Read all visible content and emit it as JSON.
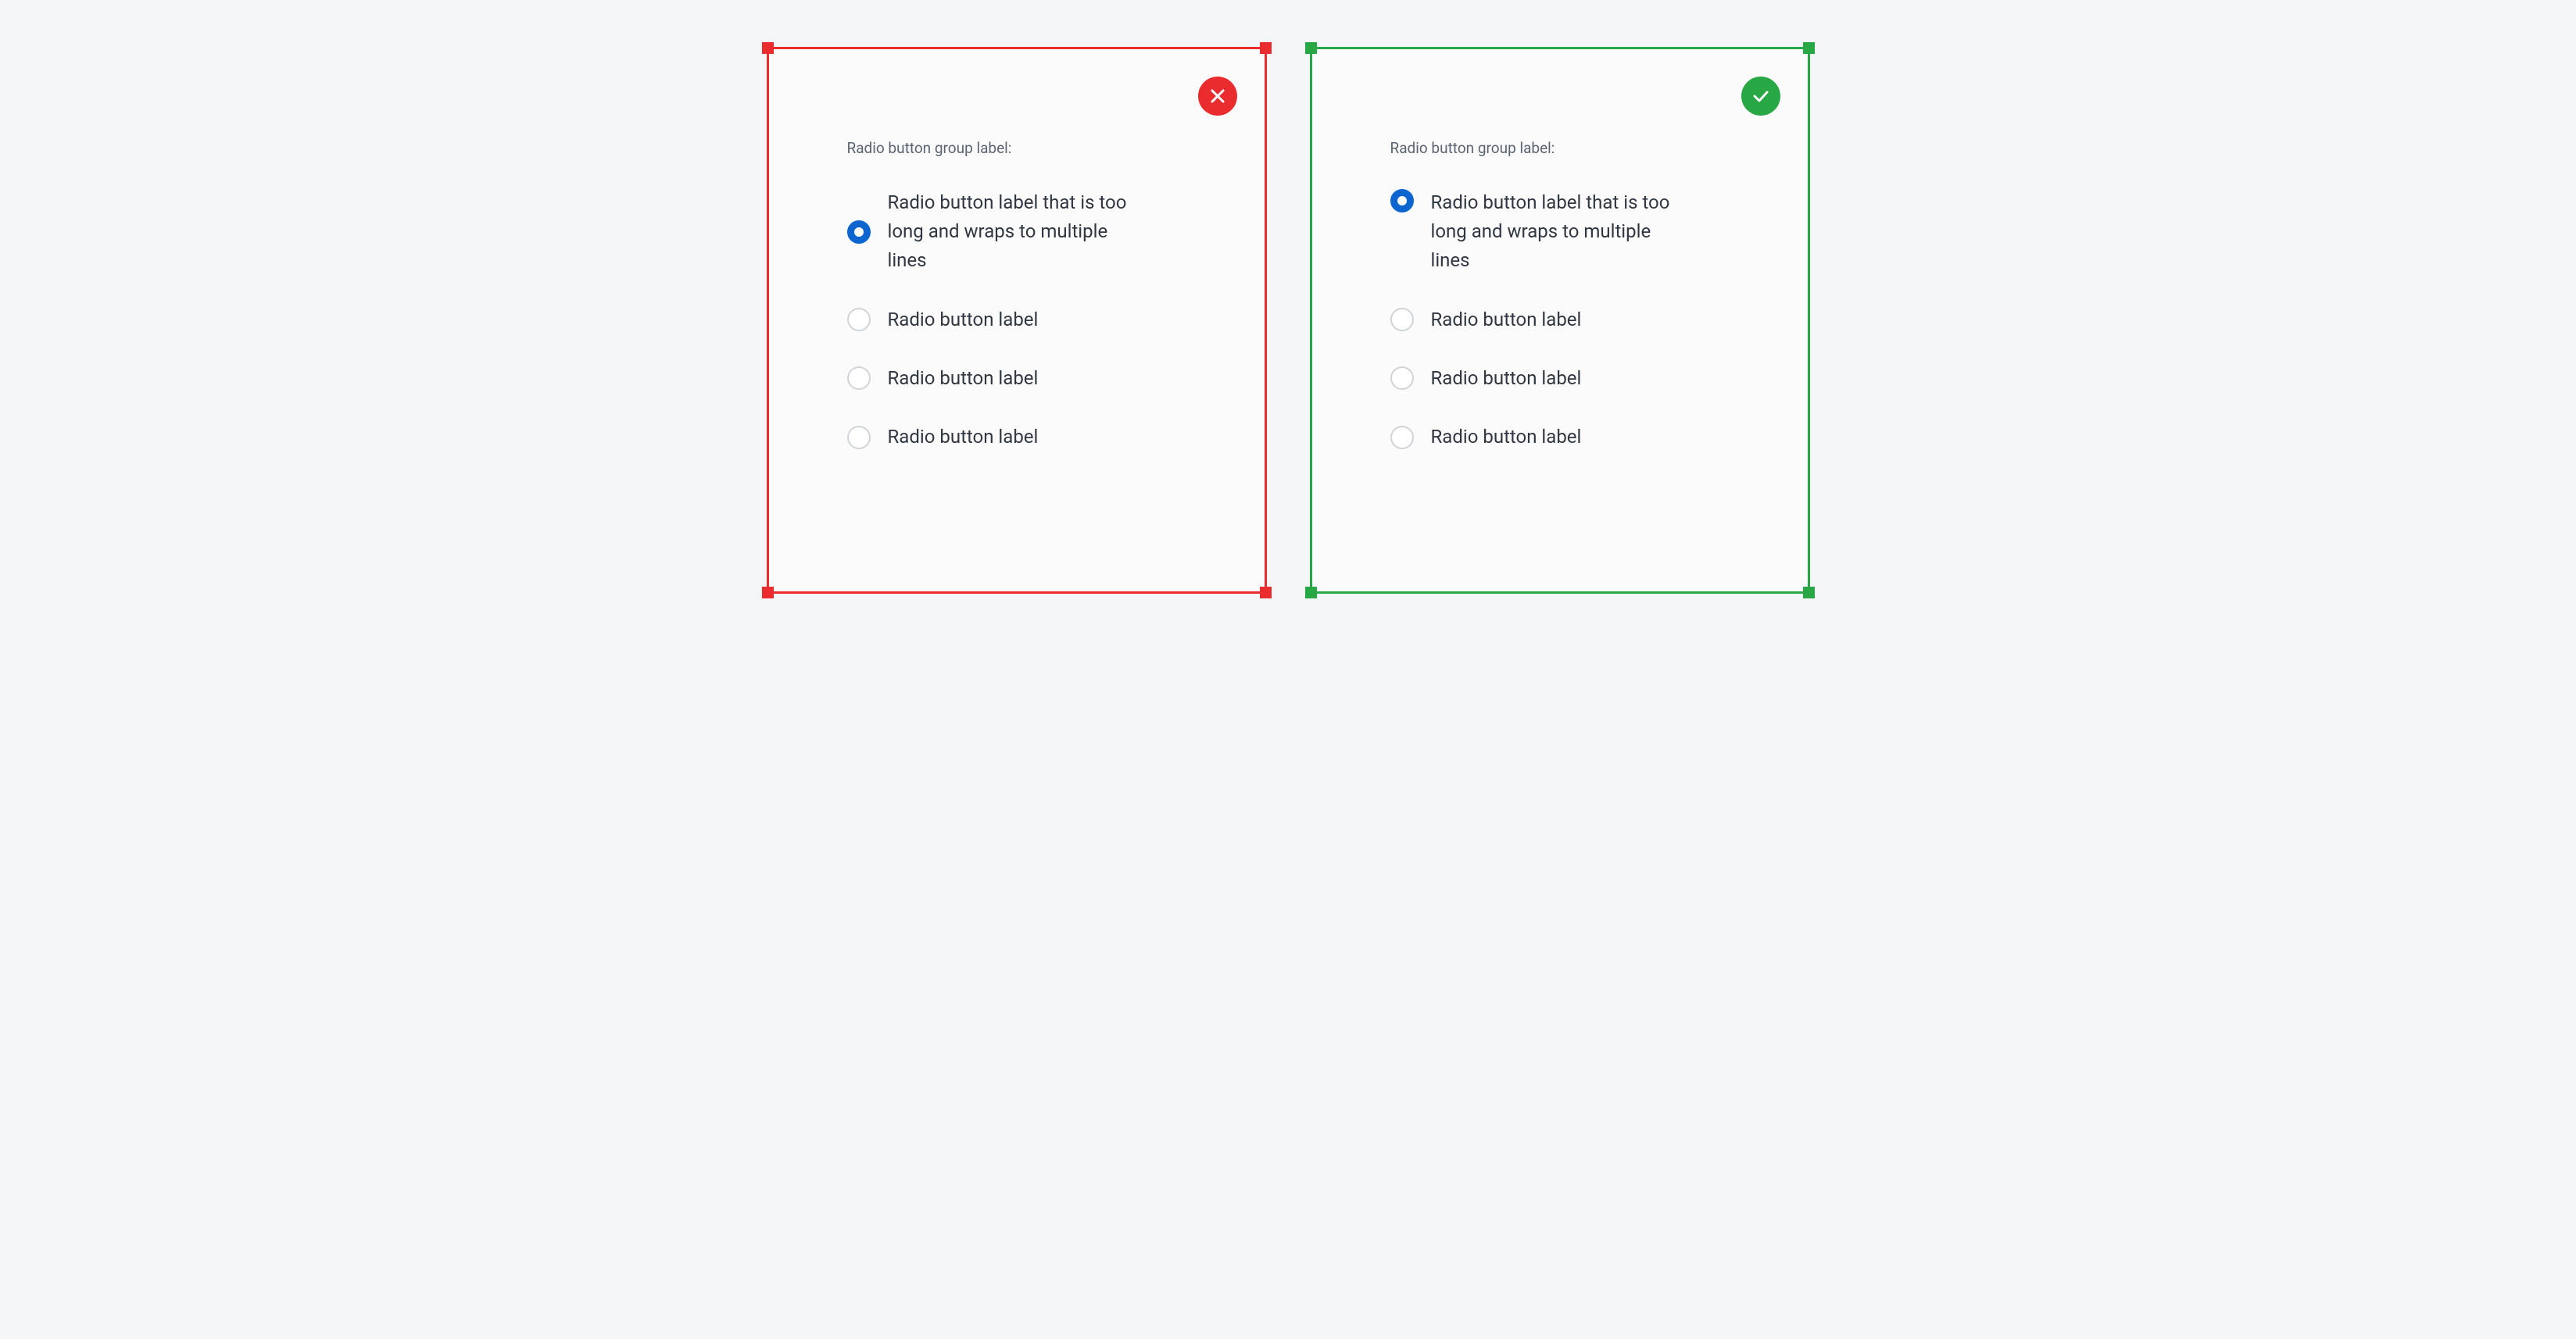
{
  "bad_panel": {
    "status": "incorrect",
    "badge_icon": "close-icon",
    "group_label": "Radio button group label:",
    "options": [
      {
        "label": "Radio button label that is too long and wraps to multiple lines",
        "selected": true
      },
      {
        "label": "Radio button label",
        "selected": false
      },
      {
        "label": "Radio button label",
        "selected": false
      },
      {
        "label": "Radio button label",
        "selected": false
      }
    ],
    "first_item_alignment": "center"
  },
  "good_panel": {
    "status": "correct",
    "badge_icon": "check-icon",
    "group_label": "Radio button group label:",
    "options": [
      {
        "label": "Radio button label that is too long and wraps to multiple lines",
        "selected": true
      },
      {
        "label": "Radio button label",
        "selected": false
      },
      {
        "label": "Radio button label",
        "selected": false
      },
      {
        "label": "Radio button label",
        "selected": false
      }
    ],
    "first_item_alignment": "top"
  }
}
